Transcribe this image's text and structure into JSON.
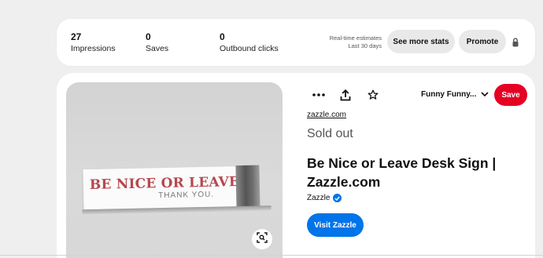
{
  "stats": {
    "impressions": {
      "value": "27",
      "label": "Impressions"
    },
    "saves": {
      "value": "0",
      "label": "Saves"
    },
    "outbound": {
      "value": "0",
      "label": "Outbound clicks"
    },
    "estimate_line1": "Real-time estimates",
    "estimate_line2": "Last 30 days",
    "see_more_label": "See more stats",
    "promote_label": "Promote"
  },
  "pin": {
    "image": {
      "sign_text": "BE NICE OR LEAVE",
      "sign_subtext": "THANK YOU."
    },
    "board_name": "Funny Funny...",
    "save_label": "Save",
    "domain": "zazzle.com",
    "status": "Sold out",
    "title": "Be Nice or Leave Desk Sign | Zazzle.com",
    "creator": "Zazzle",
    "visit_label": "Visit Zazzle"
  },
  "colors": {
    "save": "#e60023",
    "visit": "#0074e8",
    "verified": "#0074e8"
  },
  "icons": [
    "lock-icon",
    "more-icon",
    "share-icon",
    "star-icon",
    "chevron-down-icon",
    "verified-icon",
    "visual-search-icon"
  ]
}
